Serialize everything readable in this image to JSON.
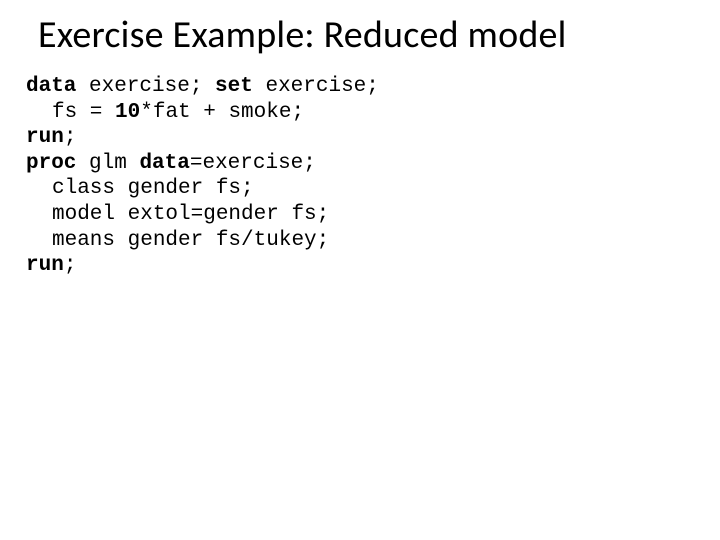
{
  "title": "Exercise Example: Reduced model",
  "code": {
    "kw_data": "data",
    "l1_a": " exercise; ",
    "kw_set": "set",
    "l1_b": " exercise;",
    "l2_a": "fs = ",
    "l2_b": "10",
    "l2_c": "*fat + smoke;",
    "kw_run1": "run",
    "l3_a": ";",
    "kw_proc": "proc",
    "l4_a": " glm ",
    "kw_data2": "data",
    "l4_b": "=exercise;",
    "l5": "class gender fs;",
    "l6": "model extol=gender fs;",
    "l7": "means gender fs/tukey;",
    "kw_run2": "run",
    "l8_a": ";"
  }
}
